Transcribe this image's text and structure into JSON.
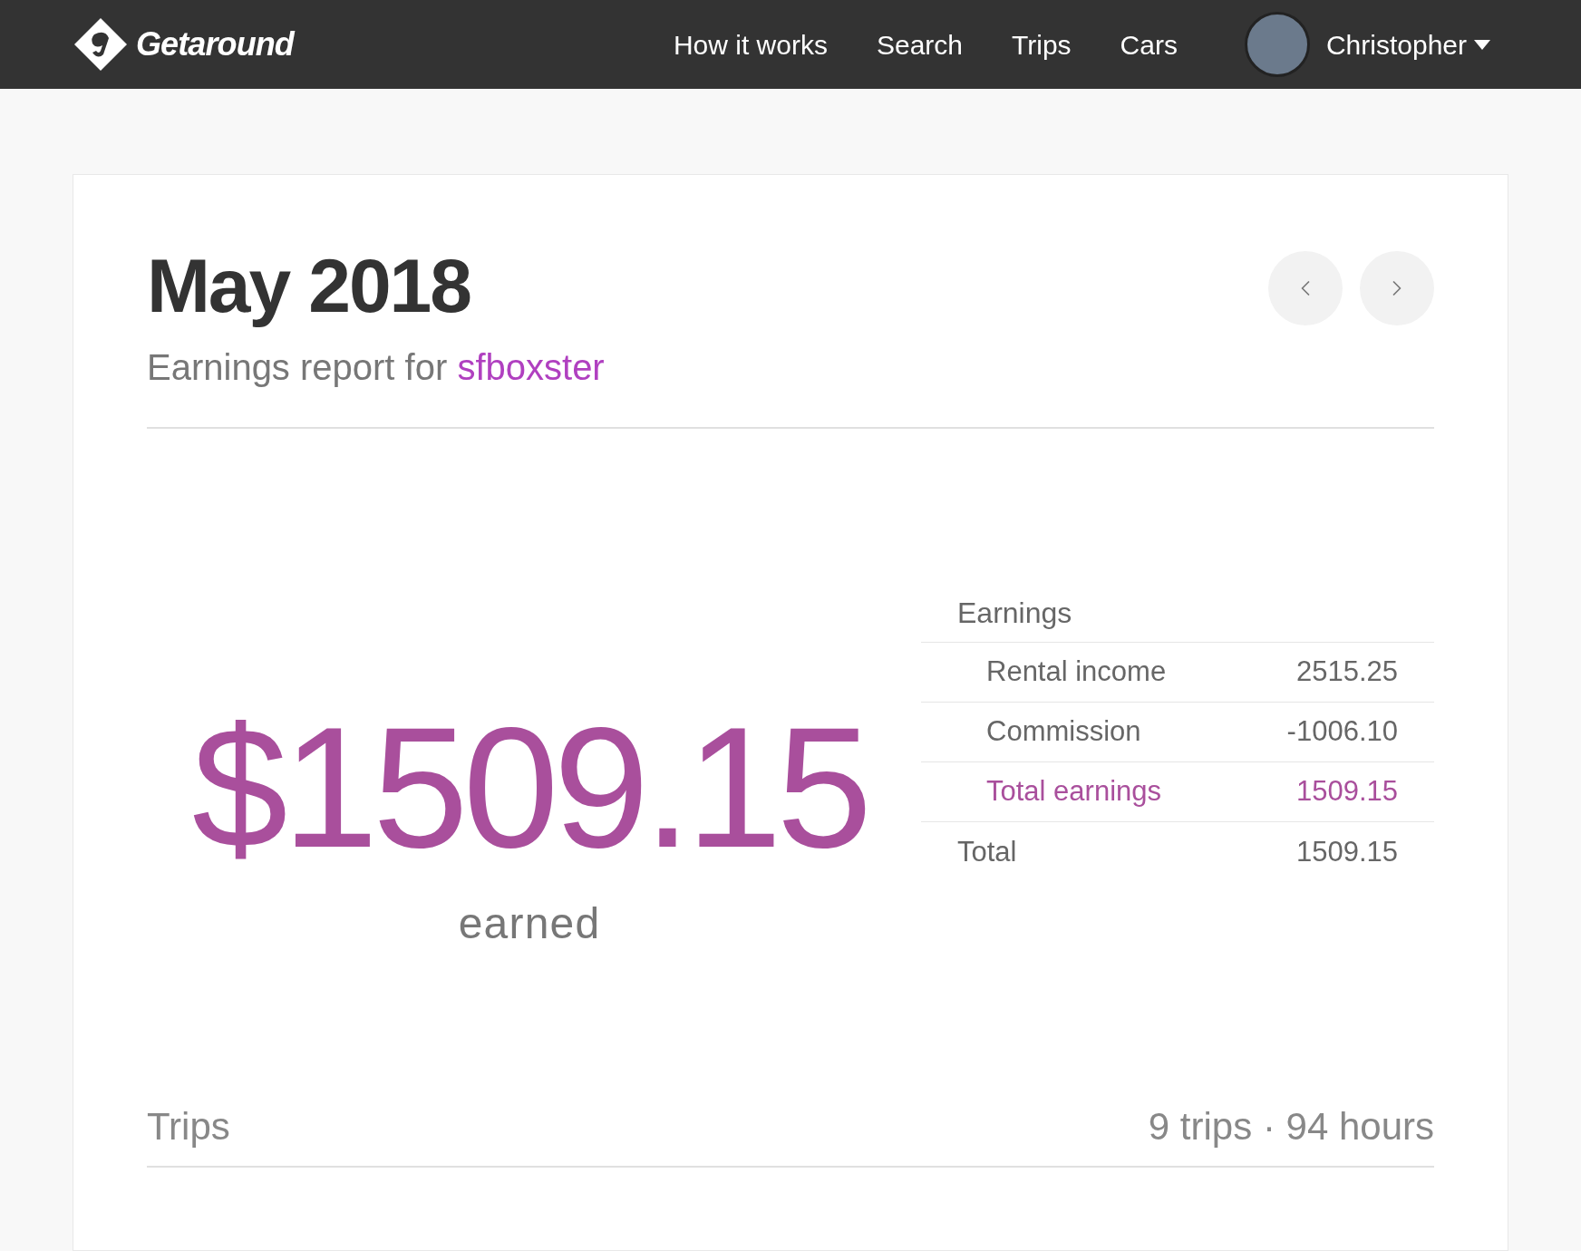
{
  "header": {
    "logo": "Getaround",
    "nav": [
      "How it works",
      "Search",
      "Trips",
      "Cars"
    ],
    "user": {
      "name": "Christopher"
    }
  },
  "report": {
    "title": "May 2018",
    "subtitle_prefix": "Earnings report for",
    "car_name": "sfboxster",
    "amount": "$1509.15",
    "amount_label": "earned",
    "earnings": {
      "heading": "Earnings",
      "rows": [
        {
          "label": "Rental income",
          "value": "2515.25",
          "kind": "item"
        },
        {
          "label": "Commission",
          "value": "-1006.10",
          "kind": "item"
        },
        {
          "label": "Total earnings",
          "value": "1509.15",
          "kind": "subtotal"
        },
        {
          "label": "Total",
          "value": "1509.15",
          "kind": "total"
        }
      ]
    },
    "trips": {
      "label": "Trips",
      "summary": "9 trips · 94 hours"
    }
  }
}
